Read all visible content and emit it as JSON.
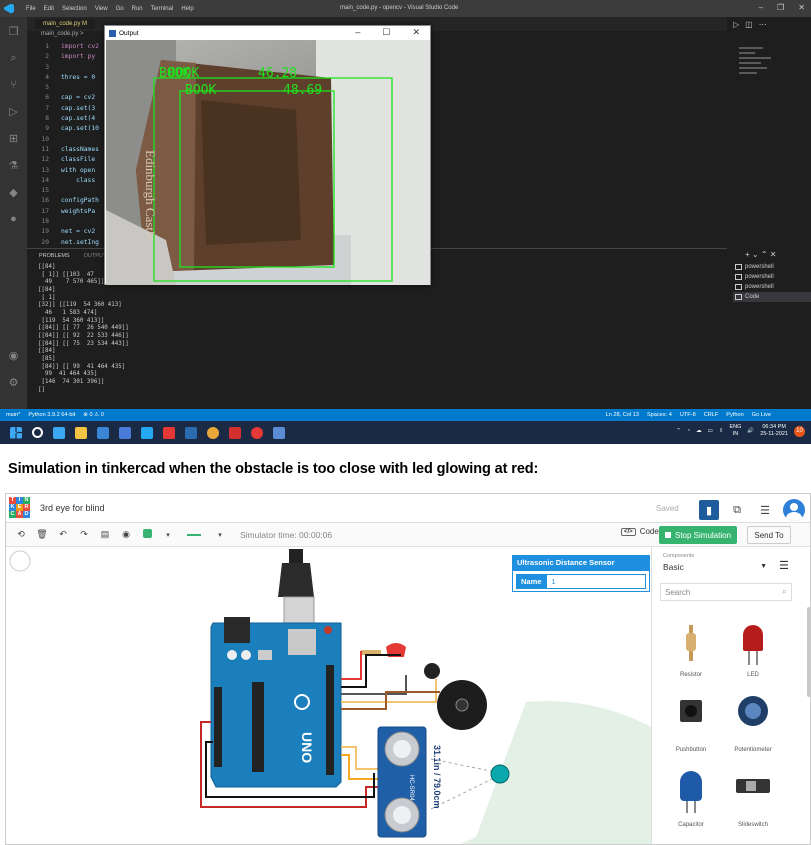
{
  "vscode": {
    "menu": [
      "File",
      "Edit",
      "Selection",
      "View",
      "Go",
      "Run",
      "Terminal",
      "Help"
    ],
    "window_title": "main_code.py - opencv - Visual Studio Code",
    "tab": "main_code.py M",
    "breadcrumb": "main_code.py >",
    "code_lines": [
      {
        "n": "1",
        "t": "import cv2"
      },
      {
        "n": "2",
        "t": "import py"
      },
      {
        "n": "3",
        "t": ""
      },
      {
        "n": "4",
        "t": "thres = 0"
      },
      {
        "n": "5",
        "t": ""
      },
      {
        "n": "6",
        "t": "cap = cv2"
      },
      {
        "n": "7",
        "t": "cap.set(3"
      },
      {
        "n": "8",
        "t": "cap.set(4"
      },
      {
        "n": "9",
        "t": "cap.set(10"
      },
      {
        "n": "10",
        "t": ""
      },
      {
        "n": "11",
        "t": "classNames"
      },
      {
        "n": "12",
        "t": "classFile"
      },
      {
        "n": "13",
        "t": "with open"
      },
      {
        "n": "14",
        "t": "    class"
      },
      {
        "n": "15",
        "t": ""
      },
      {
        "n": "16",
        "t": "configPath"
      },
      {
        "n": "17",
        "t": "weightsPa"
      },
      {
        "n": "18",
        "t": ""
      },
      {
        "n": "19",
        "t": "net = cv2"
      },
      {
        "n": "20",
        "t": "net.setIng"
      }
    ],
    "panel_tabs": [
      "PROBLEMS",
      "OUTPUT"
    ],
    "terminal_lines": "[[84]\n [ 1]] [[103  47\n  49    7 570 465]]\n[[84]\n [ 1]\n[32]] [[119  54 360 413]\n  46   1 583 474]\n [119  54 360 413]]\n[[84]] [[ 77  26 540 449]]\n[[84]] [[ 92  22 533 446]]\n[[84]] [[ 75  23 534 443]]\n[[84]\n [85]\n [84]] [[ 99  41 464 435]\n  99  41 464 435]\n [146  74 301 396]]\n[]",
    "terminals": [
      {
        "label": "powershell"
      },
      {
        "label": "powershell"
      },
      {
        "label": "powershell"
      },
      {
        "label": "Code"
      }
    ],
    "status_left": [
      "main*",
      "Python 3.9.2 64-bit",
      "⊗ 0 ⚠ 0"
    ],
    "status_right": [
      "Ln 28, Col 13",
      "Spaces: 4",
      "UTF-8",
      "CRLF",
      "Python",
      "Go Live"
    ],
    "output_window": {
      "title": "Output",
      "labels": [
        {
          "text": "BOOK",
          "score": "46.28"
        },
        {
          "text": "BOOK",
          "score": "48.69"
        }
      ],
      "book_text": "Edinburgh Castle"
    },
    "tray": {
      "lang": "ENG",
      "region": "IN",
      "time": "06:34 PM",
      "date": "25-11-2021",
      "badge": "10"
    }
  },
  "caption": "Simulation in tinkercad when the obstacle is too close with led glowing at red:",
  "tinkercad": {
    "logo_letters": [
      "T",
      "I",
      "N",
      "K",
      "E",
      "R",
      "C",
      "A",
      "D"
    ],
    "logo_colors": [
      "#e74c3c",
      "#2e86de",
      "#27ae60",
      "#2e86de",
      "#f39c12",
      "#e74c3c",
      "#27ae60",
      "#e74c3c",
      "#2e86de"
    ],
    "project_title": "3rd eye for blind",
    "saved": "Saved",
    "simulator_time": "Simulator time: 00:00:06",
    "code_button": "Code",
    "stop_button": "Stop Simulation",
    "send_button": "Send To",
    "sensor_panel": {
      "title": "Ultrasonic Distance Sensor",
      "name_label": "Name",
      "name_value": "1"
    },
    "distance_readout": "31.1in / 79.0cm",
    "sensor_label": "HC-SR04",
    "board_label": "UNO",
    "components_label": "Components",
    "components_select": "Basic",
    "search_placeholder": "Search",
    "components": [
      "Resistor",
      "LED",
      "Pushbutton",
      "Potentiometer",
      "Capacitor",
      "Slideswitch"
    ]
  }
}
